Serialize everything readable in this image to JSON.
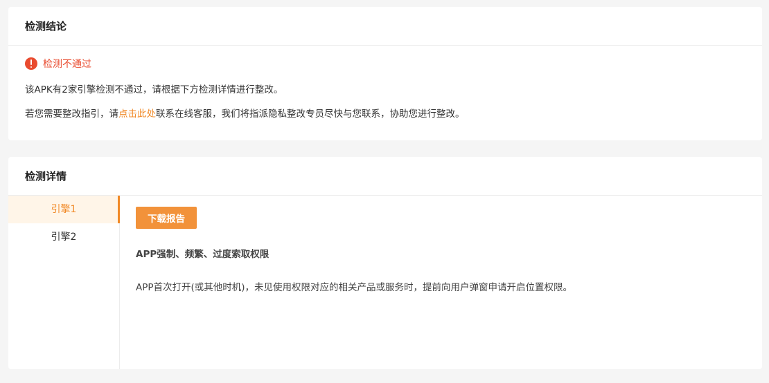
{
  "conclusion": {
    "title": "检测结论",
    "status_text": "检测不通过",
    "line1": "该APK有2家引擎检测不通过，请根据下方检测详情进行整改。",
    "line2_prefix": "若您需要整改指引，请",
    "line2_link": "点击此处",
    "line2_suffix": "联系在线客服，我们将指派隐私整改专员尽快与您联系，协助您进行整改。"
  },
  "details": {
    "title": "检测详情",
    "engines": [
      {
        "label": "引擎1",
        "active": true
      },
      {
        "label": "引擎2",
        "active": false
      }
    ],
    "download_label": "下载报告",
    "issue_title": "APP强制、频繁、过度索取权限",
    "issue_desc": "APP首次打开(或其他时机)，未见使用权限对应的相关产品或服务时，提前向用户弹窗申请开启位置权限。"
  },
  "colors": {
    "accent": "#f18a28",
    "error": "#e94b2f",
    "active_bg": "#fff5e8"
  },
  "icons": {
    "status": "warning-circle-icon"
  }
}
